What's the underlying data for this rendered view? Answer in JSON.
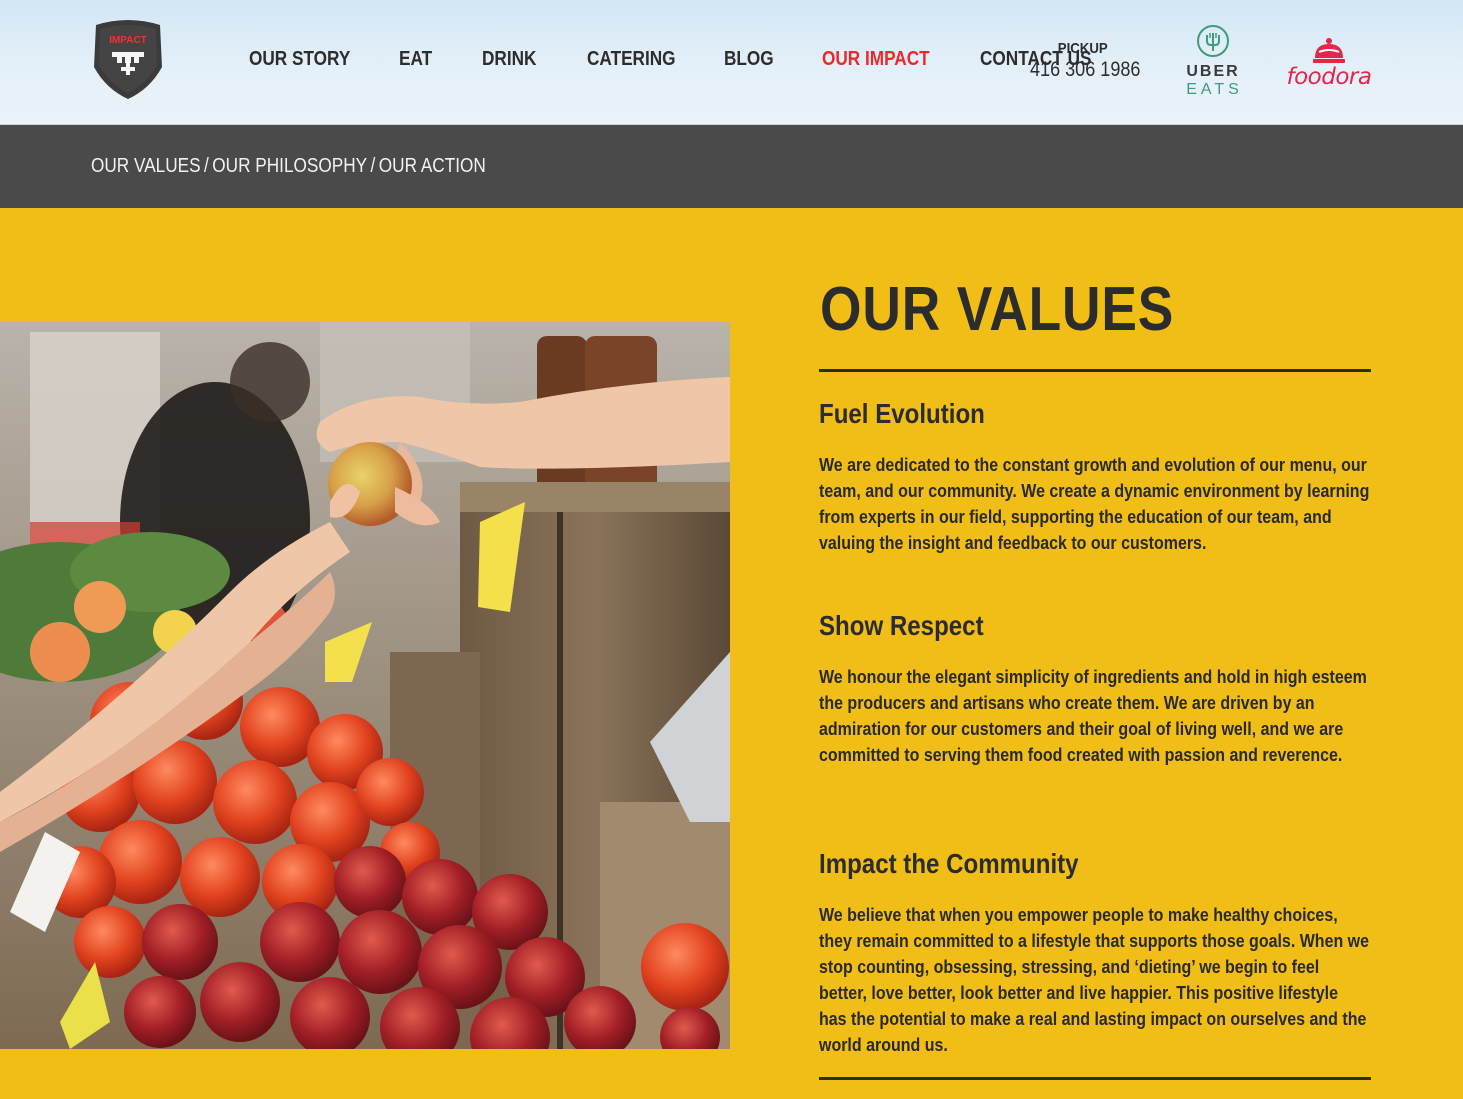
{
  "header": {
    "logo_text": "IMPACT",
    "nav": [
      {
        "label": "OUR STORY"
      },
      {
        "label": "EAT"
      },
      {
        "label": "DRINK"
      },
      {
        "label": "CATERING"
      },
      {
        "label": "BLOG"
      },
      {
        "label": "OUR IMPACT",
        "active": true
      },
      {
        "label": "CONTACT US"
      }
    ],
    "pickup": {
      "label": "PICKUP",
      "phone": "416 306 1986"
    },
    "uber_eats": {
      "line1": "UBER",
      "line2": "EATS"
    },
    "foodora": {
      "label": "foodora"
    },
    "active_color": "#ea2a2a"
  },
  "subnav": {
    "links": [
      "OUR VALUES",
      "OUR PHILOSOPHY",
      "OUR ACTION"
    ],
    "separator": "/"
  },
  "main": {
    "title": "OUR VALUES",
    "sections": [
      {
        "heading": "Fuel Evolution",
        "body": "We are dedicated to the constant growth and evolution of our menu, our team, and our community. We create a dynamic environment by learning from experts in our field, supporting the education of our team, and valuing the insight and feedback to our customers."
      },
      {
        "heading": "Show Respect",
        "body": "We honour the elegant simplicity of ingredients and hold in high esteem the producers and artisans who create them. We are driven by an admiration for our customers and their goal of living well, and we are committed to serving them food created with passion and reverence."
      },
      {
        "heading": "Impact the Community",
        "body": "We believe that when you empower people to make healthy choices, they remain committed to a lifestyle that supports those goals. When we stop counting, obsessing, stressing, and ‘dieting’ we begin to feel better, love better, look better and live happier. This positive lifestyle has the potential to make a real and lasting impact on ourselves and the world around us."
      }
    ],
    "background_color": "#f1be17"
  }
}
